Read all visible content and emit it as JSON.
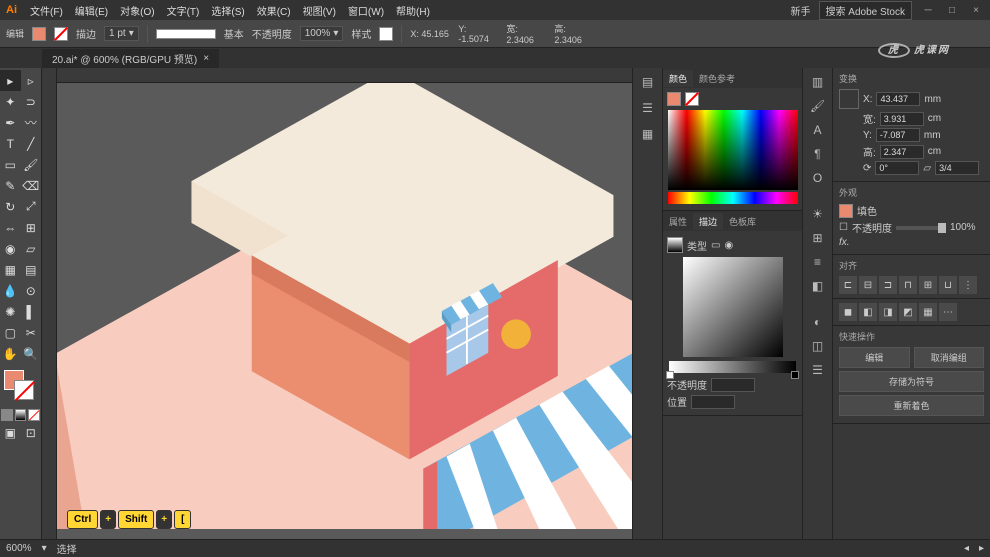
{
  "app": {
    "name": "Ai",
    "search_hint": "搜索 Adobe Stock",
    "user": "新手"
  },
  "menu": [
    "文件(F)",
    "编辑(E)",
    "对象(O)",
    "文字(T)",
    "选择(S)",
    "效果(C)",
    "视图(V)",
    "窗口(W)",
    "帮助(H)"
  ],
  "control": {
    "mode": "编辑",
    "stroke_label": "描边",
    "stroke_pt": "1 pt",
    "brush_label": "基本",
    "opacity_label": "不透明度",
    "opacity": "100%",
    "style_label": "样式",
    "coords": {
      "x": "X: 45.165",
      "y": "Y: -1.5074",
      "w": "宽: 2.3406",
      "h": "高: 2.3406"
    }
  },
  "doc": {
    "tab": "20.ai* @ 600% (RGB/GPU 预览)",
    "close": "×"
  },
  "shortcut": [
    "Ctrl",
    "+",
    "Shift",
    "+",
    "["
  ],
  "panels": {
    "color": {
      "tabs": [
        "颜色",
        "颜色参考"
      ]
    },
    "swatches": {
      "tabs": [
        "属性",
        "描边",
        "色板库"
      ]
    },
    "gradient": {
      "label": "类型",
      "opacity": "不透明度",
      "position": "位置"
    }
  },
  "right": {
    "transform": {
      "title": "变换",
      "x": "43.437",
      "xu": "mm",
      "w": "3.931",
      "wu": "cm",
      "y": "-7.087",
      "yu": "mm",
      "h": "2.347",
      "hu": "cm",
      "angle": "0°",
      "shear": "3/4"
    },
    "appearance": {
      "title": "外观",
      "fill": "填色",
      "opacity_label": "不透明度",
      "opacity": "100%"
    },
    "align": {
      "title": "对齐"
    },
    "quick": {
      "title": "快速操作",
      "btns": [
        "编辑",
        "取消编组",
        "存储为符号",
        "重新着色"
      ]
    }
  },
  "status": {
    "zoom": "600%",
    "tool": "选择"
  },
  "watermark": "虎课网"
}
